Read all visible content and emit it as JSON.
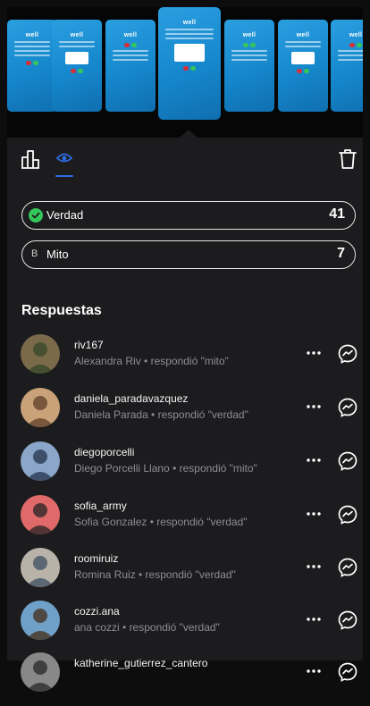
{
  "stories": [
    {
      "brand": "well",
      "dot_colors": [
        "#d62f3a",
        "#34c759"
      ]
    },
    {
      "brand": "well",
      "dot_colors": [
        "#d62f3a",
        "#34c759"
      ]
    },
    {
      "brand": "well",
      "dot_colors": [
        "#d62f3a",
        "#34c759"
      ]
    },
    {
      "brand": "well",
      "dot_colors": [
        "#d62f3a",
        "#34c759"
      ]
    },
    {
      "brand": "well",
      "dot_colors": [
        "#34c759",
        "#34c759"
      ]
    },
    {
      "brand": "well",
      "dot_colors": [
        "#d62f3a",
        "#34c759"
      ]
    },
    {
      "brand": "well",
      "dot_colors": [
        "#d62f3a",
        "#34c759"
      ]
    }
  ],
  "tabs": {
    "chart": "chart-icon",
    "viewers": "eye-icon",
    "active_color": "#2d6cdf"
  },
  "poll": {
    "options": [
      {
        "label": "Verdad",
        "count": "41",
        "icon": "check-icon",
        "icon_color": "#34c759"
      },
      {
        "letter": "B",
        "label": "Mito",
        "count": "7"
      }
    ]
  },
  "responses": {
    "heading": "Respuestas",
    "items": [
      {
        "username": "riv167",
        "subtitle": "Alexandra Riv • respondió \"mito\"",
        "avatar_colors": [
          "#7a6a4a",
          "#3d4a2a"
        ]
      },
      {
        "username": "daniela_paradavazquez",
        "subtitle": "Daniela Parada • respondió \"verdad\"",
        "avatar_colors": [
          "#c9a27a",
          "#6b4a33"
        ]
      },
      {
        "username": "diegoporcelli",
        "subtitle": "Diego Porcelli Llano • respondió \"mito\"",
        "avatar_colors": [
          "#8aa6c9",
          "#2f3f5a"
        ]
      },
      {
        "username": "sofia_army",
        "subtitle": "Sofia Gonzalez • respondió \"verdad\"",
        "avatar_colors": [
          "#e06a6a",
          "#3a2a2a"
        ]
      },
      {
        "username": "roomiruiz",
        "subtitle": "Romina Ruiz • respondió \"verdad\"",
        "avatar_colors": [
          "#b9b2a8",
          "#4a5a6a"
        ]
      },
      {
        "username": "cozzi.ana",
        "subtitle": "ana cozzi • respondió \"verdad\"",
        "avatar_colors": [
          "#6fa0c8",
          "#4a3a2a"
        ]
      },
      {
        "username": "katherine_gutierrez_cantero",
        "subtitle": "",
        "avatar_colors": [
          "#888888",
          "#333333"
        ]
      }
    ]
  }
}
